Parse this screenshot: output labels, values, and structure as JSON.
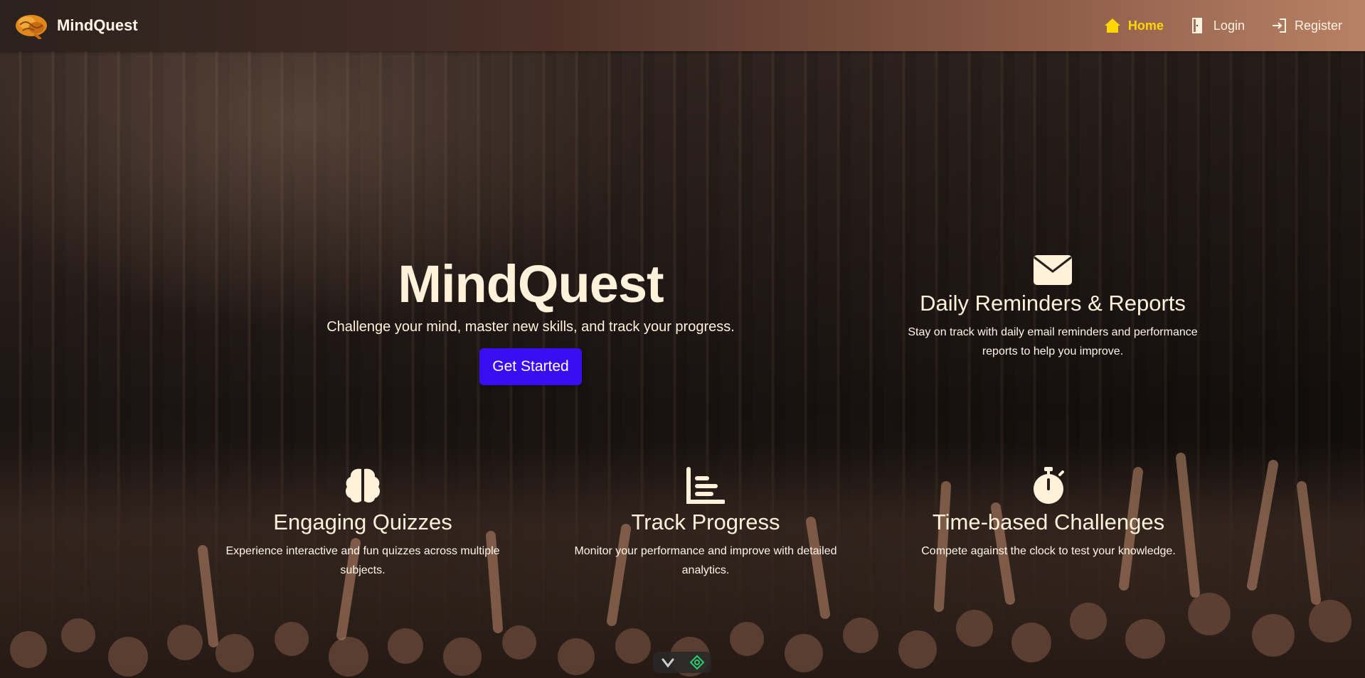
{
  "brand": {
    "name": "MindQuest",
    "logo_icon": "brain-logo-icon"
  },
  "nav": {
    "items": [
      {
        "label": "Home",
        "icon": "home-icon",
        "active": true
      },
      {
        "label": "Login",
        "icon": "door-icon",
        "active": false
      },
      {
        "label": "Register",
        "icon": "sign-in-icon",
        "active": false
      }
    ]
  },
  "hero": {
    "title": "MindQuest",
    "subtitle": "Challenge your mind, master new skills, and track your progress.",
    "cta_label": "Get Started"
  },
  "features": [
    {
      "icon": "envelope-icon",
      "title": "Daily Reminders & Reports",
      "description": "Stay on track with daily email reminders and performance reports to help you improve."
    },
    {
      "icon": "brain-icon",
      "title": "Engaging Quizzes",
      "description": "Experience interactive and fun quizzes across multiple subjects."
    },
    {
      "icon": "bar-chart-icon",
      "title": "Track Progress",
      "description": "Monitor your performance and improve with detailed analytics."
    },
    {
      "icon": "stopwatch-icon",
      "title": "Time-based Challenges",
      "description": "Compete against the clock to test your knowledge."
    }
  ],
  "colors": {
    "accent_button": "#3a0ef2",
    "nav_active": "#ffd600",
    "text_cream": "#fff1da"
  }
}
